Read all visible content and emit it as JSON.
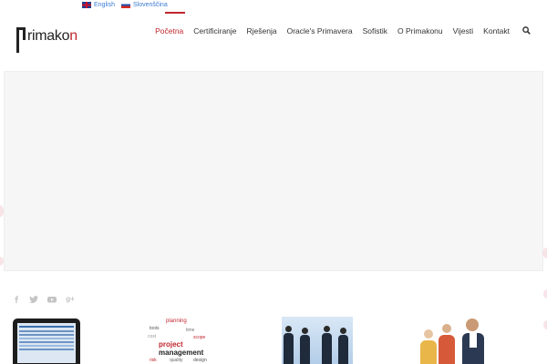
{
  "languages": [
    {
      "label": "English",
      "flag": "uk-flag-icon"
    },
    {
      "label": "Slovenščina",
      "flag": "slovenia-flag-icon"
    }
  ],
  "logo": {
    "part1": "rimako",
    "part2": "n"
  },
  "nav": {
    "items": [
      "Početna",
      "Certificiranje",
      "Rješenja",
      "Oracle's Primavera",
      "Sofistik",
      "O Primakonu",
      "Vijesti",
      "Kontakt"
    ],
    "active_index": 0
  },
  "social": [
    "facebook-icon",
    "twitter-icon",
    "youtube-icon",
    "google-plus-icon"
  ],
  "thumbnails": {
    "cloud_words": [
      "project",
      "management",
      "planning",
      "tools",
      "time",
      "cost",
      "scope",
      "risk",
      "quality",
      "design",
      "team",
      "budget"
    ]
  },
  "colors": {
    "accent": "#c0262d",
    "link": "#3a7bd5",
    "text": "#333333"
  }
}
